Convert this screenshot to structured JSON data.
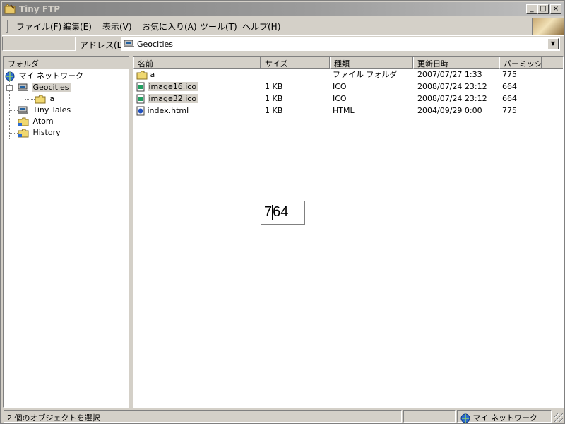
{
  "window": {
    "title": "Tiny FTP"
  },
  "menubar": {
    "items": [
      "ファイル(F)",
      "編集(E)",
      "表示(V)",
      "お気に入り(A)",
      "ツール(T)",
      "ヘルプ(H)"
    ]
  },
  "address": {
    "label": "アドレス(D)",
    "value": "Geocities"
  },
  "folder_pane": {
    "header": "フォルダ",
    "tree": [
      {
        "label": "マイ ネットワーク",
        "icon": "network-icon"
      },
      {
        "label": "Geocities",
        "icon": "server-icon",
        "selected": true
      },
      {
        "label": "a",
        "icon": "folder-icon"
      },
      {
        "label": "Tiny Tales",
        "icon": "server-icon"
      },
      {
        "label": "Atom",
        "icon": "folder-icon"
      },
      {
        "label": "History",
        "icon": "folder-icon"
      }
    ]
  },
  "file_list": {
    "columns": [
      "名前",
      "サイズ",
      "種類",
      "更新日時",
      "パーミッシ..."
    ],
    "rows": [
      {
        "name": "a",
        "size": "",
        "type": "ファイル フォルダ",
        "modified": "2007/07/27 1:33",
        "perm": "775",
        "icon": "folder-icon",
        "selected": false
      },
      {
        "name": "image16.ico",
        "size": "1 KB",
        "type": "ICO",
        "modified": "2008/07/24 23:12",
        "perm": "664",
        "icon": "ico-file-icon",
        "selected": true
      },
      {
        "name": "image32.ico",
        "size": "1 KB",
        "type": "ICO",
        "modified": "2008/07/24 23:12",
        "perm": "664",
        "icon": "ico-file-icon",
        "selected": true
      },
      {
        "name": "index.html",
        "size": "1 KB",
        "type": "HTML",
        "modified": "2004/09/29 0:00",
        "perm": "775",
        "icon": "html-file-icon",
        "selected": false
      }
    ]
  },
  "edit_box": {
    "before_caret": "7",
    "after_caret": "64"
  },
  "statusbar": {
    "selection_text": "2 個のオブジェクトを選択",
    "zone_text": "マイ ネットワーク"
  }
}
